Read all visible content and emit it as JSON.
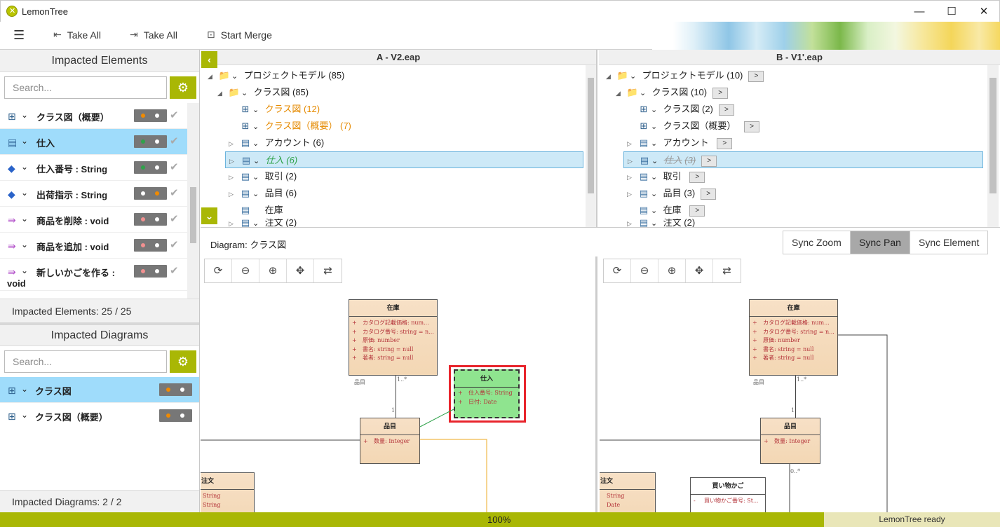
{
  "window": {
    "title": "LemonTree",
    "minimize": "—",
    "maximize": "☐",
    "close": "✕"
  },
  "toolbar": {
    "menu_icon": "☰",
    "take_all_left": "Take All",
    "take_all_right": "Take All",
    "start_merge": "Start Merge"
  },
  "impacted_elements": {
    "header": "Impacted Elements",
    "search_placeholder": "Search...",
    "items": [
      {
        "label": "クラス図（概要）",
        "icon": "diagram-icon"
      },
      {
        "label": "仕入",
        "icon": "class-icon"
      },
      {
        "label": "仕入番号 : String",
        "icon": "attribute-icon"
      },
      {
        "label": "出荷指示 : String",
        "icon": "attribute-icon"
      },
      {
        "label": "商品を削除 : void",
        "icon": "operation-icon"
      },
      {
        "label": "商品を追加 : void",
        "icon": "operation-icon"
      },
      {
        "label": "新しいかごを作る :",
        "label2": "void",
        "icon": "operation-icon"
      }
    ],
    "footer": "Impacted Elements: 25 / 25"
  },
  "impacted_diagrams": {
    "header": "Impacted Diagrams",
    "search_placeholder": "Search...",
    "items": [
      {
        "label": "クラス図"
      },
      {
        "label": "クラス図（概要）"
      }
    ],
    "footer": "Impacted Diagrams: 2 / 2"
  },
  "tree_a": {
    "title": "A - V2.eap",
    "rows": [
      {
        "label": "プロジェクトモデル",
        "count": "(85)"
      },
      {
        "label": "クラス図",
        "count": "(85)"
      },
      {
        "label": "クラス図",
        "count": "(12)"
      },
      {
        "label": "クラス図（概要）",
        "count": "(7)"
      },
      {
        "label": "アカウント",
        "count": "(6)"
      },
      {
        "label": "仕入",
        "count": "(6)"
      },
      {
        "label": "取引",
        "count": "(2)"
      },
      {
        "label": "品目",
        "count": "(6)"
      },
      {
        "label": "在庫",
        "count": ""
      },
      {
        "label": "注文",
        "count": "(2)"
      }
    ]
  },
  "tree_b": {
    "title": "B - V1'.eap",
    "goto": ">",
    "rows": [
      {
        "label": "プロジェクトモデル",
        "count": "(10)"
      },
      {
        "label": "クラス図",
        "count": "(10)"
      },
      {
        "label": "クラス図",
        "count": "(2)"
      },
      {
        "label": "クラス図（概要）",
        "count": ""
      },
      {
        "label": "アカウント",
        "count": ""
      },
      {
        "label": "仕入",
        "count": "(3)"
      },
      {
        "label": "取引",
        "count": ""
      },
      {
        "label": "品目",
        "count": "(3)"
      },
      {
        "label": "在庫",
        "count": ""
      },
      {
        "label": "注文",
        "count": "(2)"
      }
    ]
  },
  "diagram": {
    "label": "Diagram: クラス図",
    "sync_zoom": "Sync Zoom",
    "sync_pan": "Sync Pan",
    "sync_element": "Sync Element"
  },
  "uml": {
    "zaiko": {
      "name": "在庫",
      "attrs": [
        "カタログ記載価格: num...",
        "カタログ番号: string = n...",
        "原価: number",
        "書名: string = null",
        "著者: string = null"
      ]
    },
    "shiire": {
      "name": "仕入",
      "attrs": [
        "仕入番号: String",
        "日付: Date"
      ]
    },
    "hinmoku": {
      "name": "品目",
      "attrs": [
        "数量: Integer"
      ]
    },
    "chumon": {
      "name": "注文",
      "attrs": [
        "String",
        "String",
        "Date",
        "String"
      ]
    },
    "kago": {
      "name": "買い物かご",
      "attrs": [
        "買い物かご番号: St..."
      ]
    },
    "plus": "+",
    "minus": "-",
    "mult_hinmoku": "品目",
    "mult_many": "1..*",
    "mult_one": "1",
    "mult_zero_many": "0..*"
  },
  "status": {
    "zoom": "100%",
    "state": "LemonTree ready"
  },
  "colors": {
    "accent": "#a9b705",
    "selection": "#9fdcfb",
    "orange": "#e58a00",
    "green": "#2fa24a",
    "highlight_red": "#e8242c"
  }
}
